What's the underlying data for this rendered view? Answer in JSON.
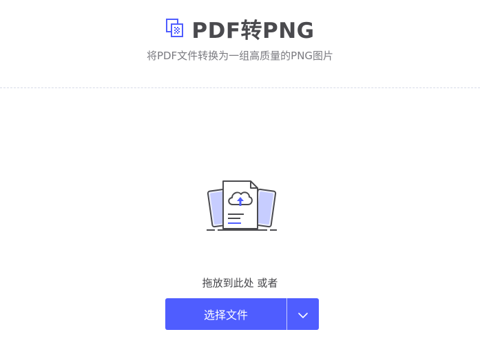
{
  "header": {
    "title": "PDF转PNG",
    "subtitle": "将PDF文件转换为一组高质量的PNG图片",
    "title_icon": "copy-pages-icon"
  },
  "upload": {
    "illustration_icon": "cloud-upload-document-icon",
    "drop_hint": "拖放到此处 或者",
    "select_button_label": "选择文件",
    "dropdown_icon": "chevron-down-icon"
  },
  "colors": {
    "accent": "#4f5dff",
    "title_text": "#4a4a4e",
    "subtitle_text": "#7a7a80",
    "divider": "#d7dbe8"
  }
}
